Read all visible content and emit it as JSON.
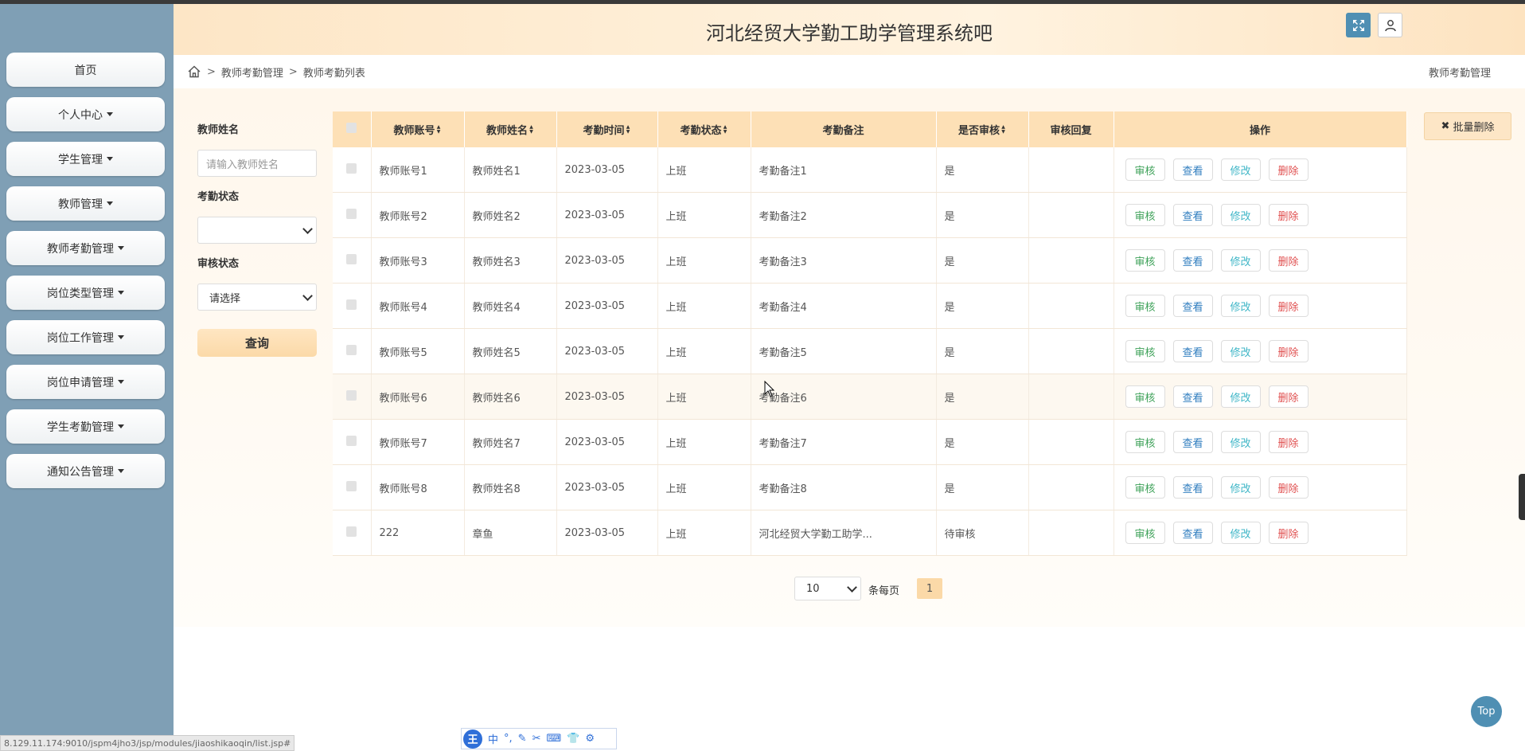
{
  "app": {
    "title": "河北经贸大学勤工助学管理系统吧"
  },
  "sidebar": {
    "items": [
      {
        "label": "首页",
        "has_caret": false
      },
      {
        "label": "个人中心",
        "has_caret": true
      },
      {
        "label": "学生管理",
        "has_caret": true
      },
      {
        "label": "教师管理",
        "has_caret": true
      },
      {
        "label": "教师考勤管理",
        "has_caret": true
      },
      {
        "label": "岗位类型管理",
        "has_caret": true
      },
      {
        "label": "岗位工作管理",
        "has_caret": true
      },
      {
        "label": "岗位申请管理",
        "has_caret": true
      },
      {
        "label": "学生考勤管理",
        "has_caret": true
      },
      {
        "label": "通知公告管理",
        "has_caret": true
      }
    ]
  },
  "breadcrumb": {
    "items": [
      "教师考勤管理",
      "教师考勤列表"
    ],
    "right": "教师考勤管理"
  },
  "filters": {
    "teacher_name_label": "教师姓名",
    "teacher_name_placeholder": "请输入教师姓名",
    "attendance_status_label": "考勤状态",
    "attendance_status_value": "",
    "audit_status_label": "审核状态",
    "audit_status_value": "请选择",
    "query_label": "查询"
  },
  "table": {
    "headers": [
      "教师账号",
      "教师姓名",
      "考勤时间",
      "考勤状态",
      "考勤备注",
      "是否审核",
      "审核回复",
      "操作"
    ],
    "sortable": [
      true,
      true,
      true,
      true,
      false,
      true,
      false,
      false
    ],
    "actions": {
      "audit": "审核",
      "view": "查看",
      "edit": "修改",
      "delete": "删除"
    },
    "rows": [
      {
        "account": "教师账号1",
        "name": "教师姓名1",
        "time": "2023-03-05",
        "status": "上班",
        "note": "考勤备注1",
        "audited": "是",
        "reply": ""
      },
      {
        "account": "教师账号2",
        "name": "教师姓名2",
        "time": "2023-03-05",
        "status": "上班",
        "note": "考勤备注2",
        "audited": "是",
        "reply": ""
      },
      {
        "account": "教师账号3",
        "name": "教师姓名3",
        "time": "2023-03-05",
        "status": "上班",
        "note": "考勤备注3",
        "audited": "是",
        "reply": ""
      },
      {
        "account": "教师账号4",
        "name": "教师姓名4",
        "time": "2023-03-05",
        "status": "上班",
        "note": "考勤备注4",
        "audited": "是",
        "reply": ""
      },
      {
        "account": "教师账号5",
        "name": "教师姓名5",
        "time": "2023-03-05",
        "status": "上班",
        "note": "考勤备注5",
        "audited": "是",
        "reply": ""
      },
      {
        "account": "教师账号6",
        "name": "教师姓名6",
        "time": "2023-03-05",
        "status": "上班",
        "note": "考勤备注6",
        "audited": "是",
        "reply": ""
      },
      {
        "account": "教师账号7",
        "name": "教师姓名7",
        "time": "2023-03-05",
        "status": "上班",
        "note": "考勤备注7",
        "audited": "是",
        "reply": ""
      },
      {
        "account": "教师账号8",
        "name": "教师姓名8",
        "time": "2023-03-05",
        "status": "上班",
        "note": "考勤备注8",
        "audited": "是",
        "reply": ""
      },
      {
        "account": "222",
        "name": "章鱼",
        "time": "2023-03-05",
        "status": "上班",
        "note": "河北经贸大学勤工助学...",
        "audited": "待审核",
        "reply": ""
      }
    ]
  },
  "batch_delete_label": "批量删除",
  "pagination": {
    "page_size": "10",
    "per_page_label": "条每页",
    "current_page": "1"
  },
  "top_button_label": "Top",
  "status_url": "8.129.11.174:9010/jspm4jho3/jsp/modules/jiaoshikaoqin/list.jsp#",
  "ime": {
    "logo": "王",
    "mode": "中",
    "punct": "°,"
  }
}
